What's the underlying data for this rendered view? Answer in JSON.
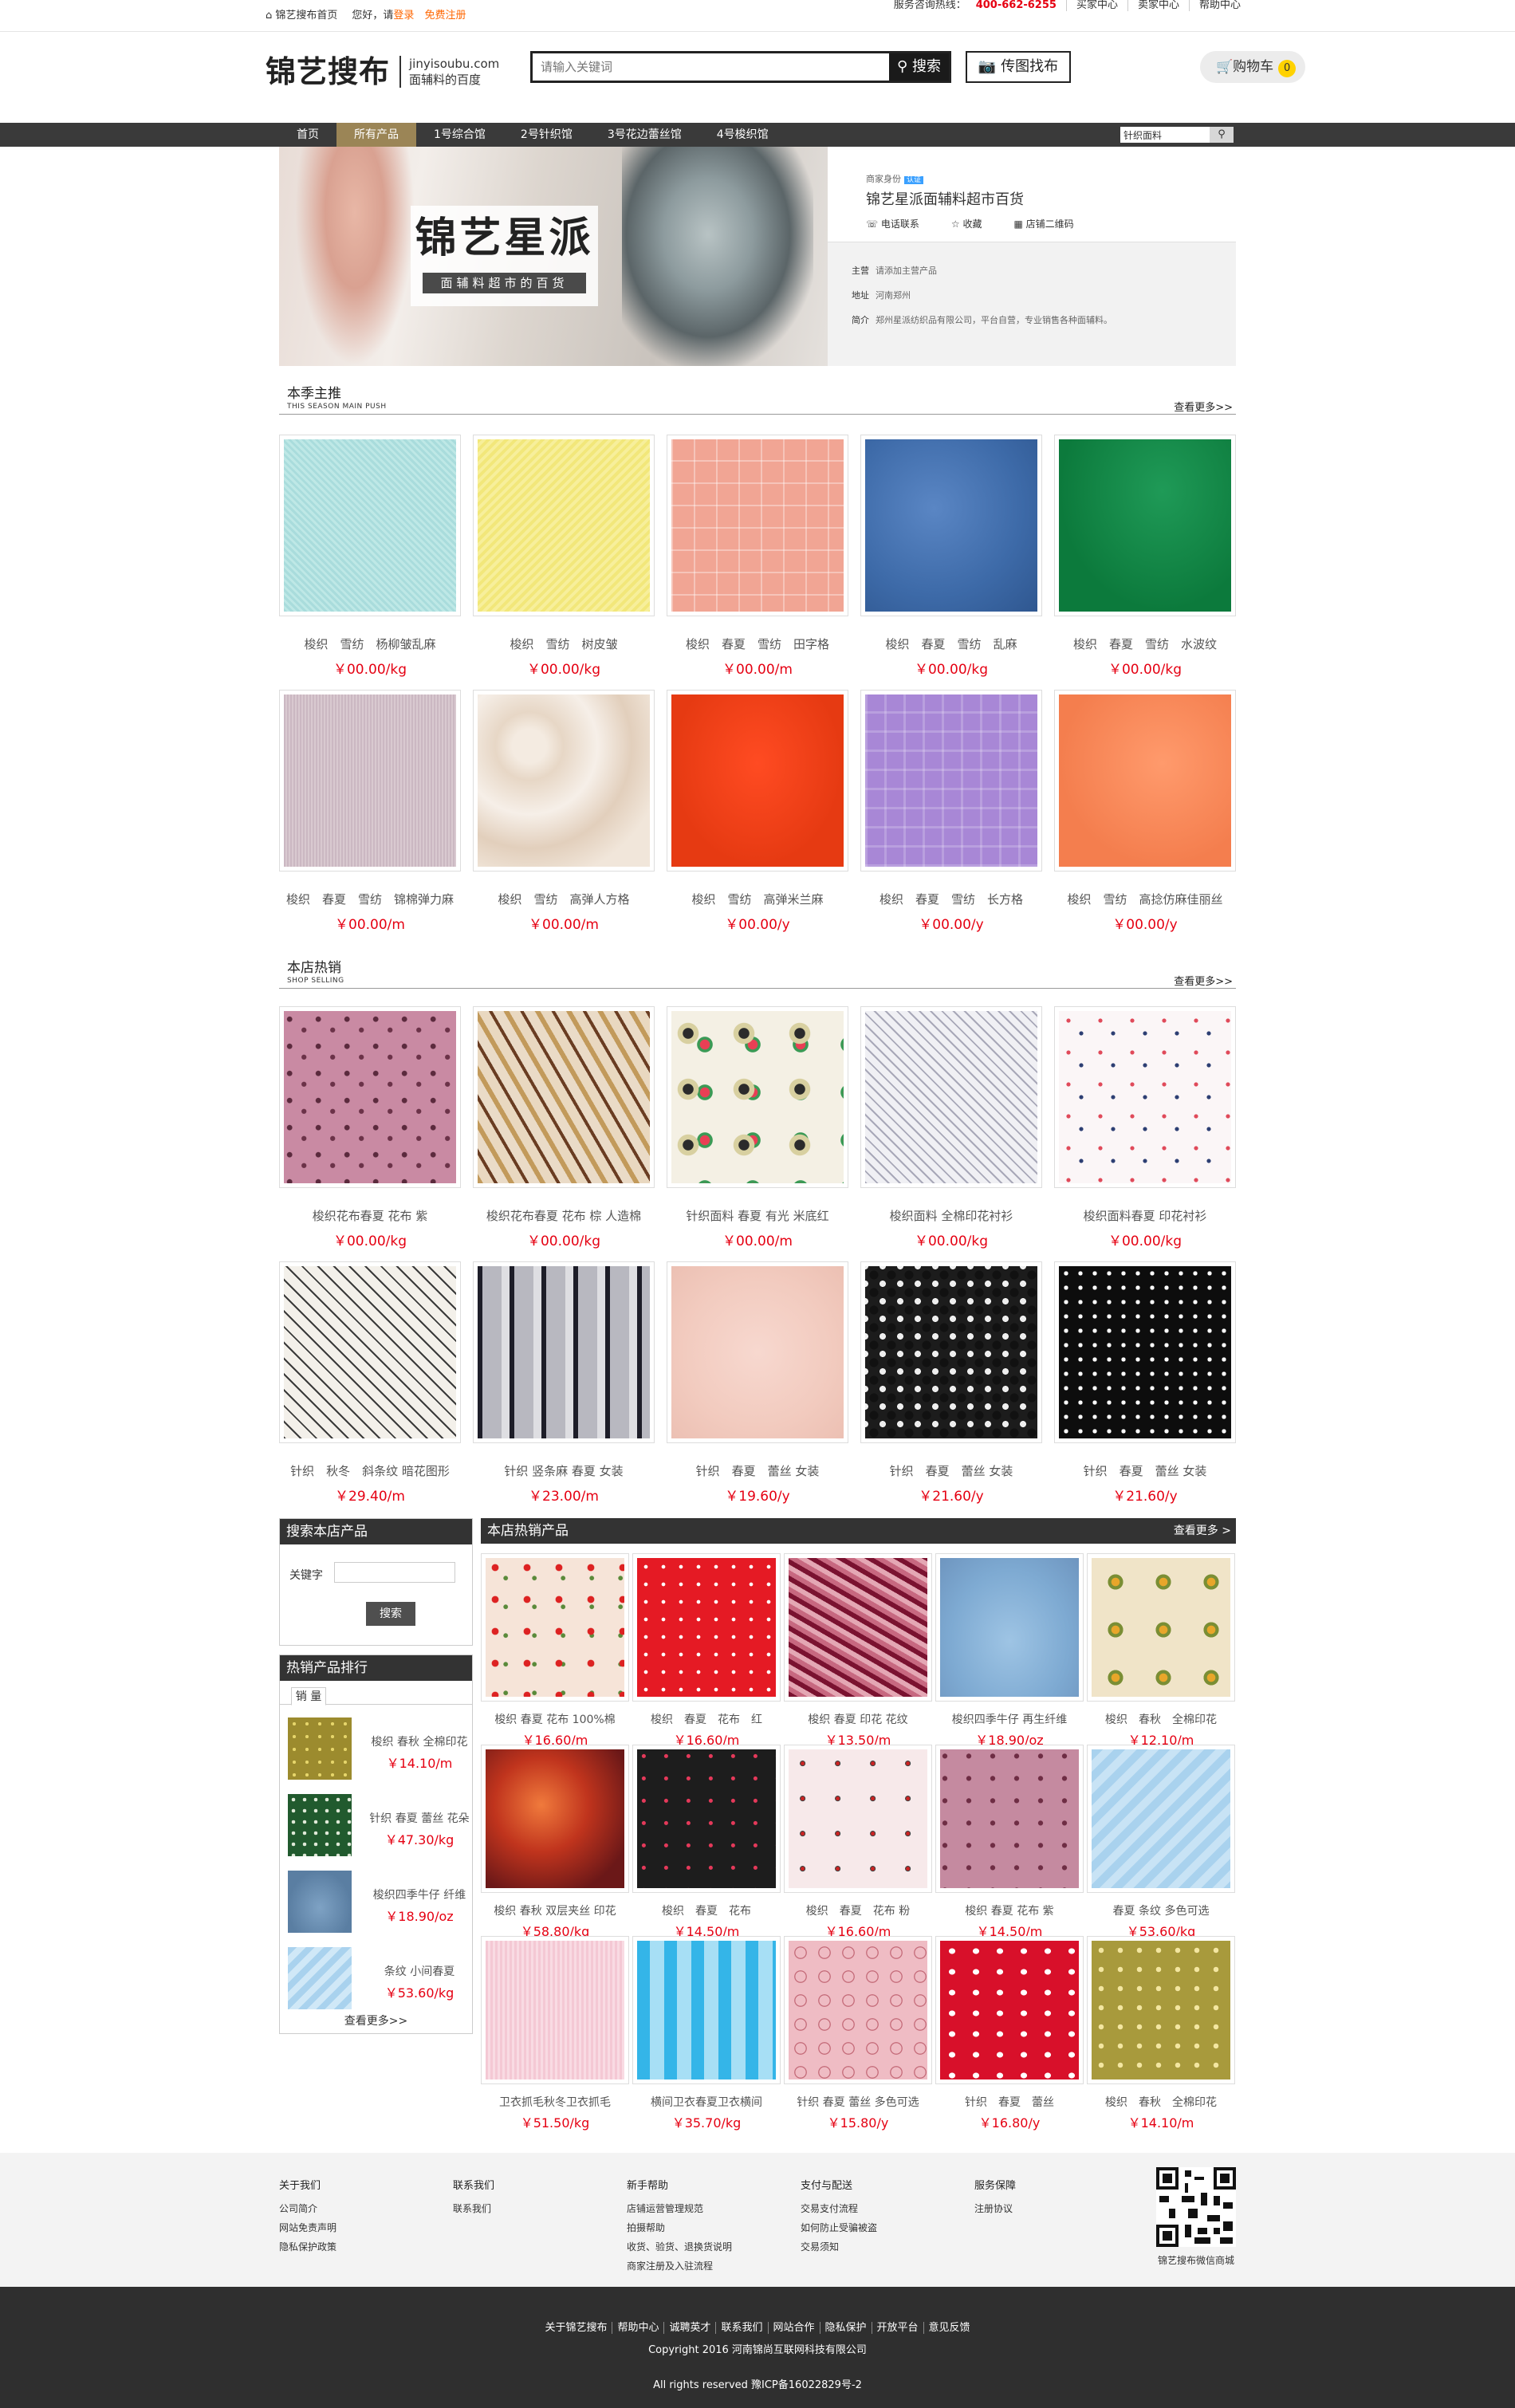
{
  "topbar": {
    "home": "锦艺搜布首页",
    "greeting": "您好，请",
    "login": "登录",
    "register": "免费注册",
    "hotline_label": "服务咨询热线：",
    "hotline": "400-662-6255",
    "buyer_center": "买家中心",
    "seller_center": "卖家中心",
    "help_center": "帮助中心"
  },
  "header": {
    "brand": "锦艺搜布",
    "domain": "jinyisoubu.com",
    "slogan": "面辅料的百度",
    "search_placeholder": "请输入关键词",
    "search_button": "搜索",
    "picture_search": "传图找布",
    "cart_label": "购物车",
    "cart_count": "0"
  },
  "nav": {
    "items": [
      "首页",
      "所有产品",
      "1号综合馆",
      "2号针织馆",
      "3号花边蕾丝馆",
      "4号梭织馆"
    ],
    "active_index": 1,
    "search_value": "针织面料"
  },
  "banner": {
    "title": "锦艺星派",
    "subtitle": "面辅料超市的百货"
  },
  "shop": {
    "identity_label": "商家身份",
    "identity_tag": "认证",
    "name": "锦艺星派面辅料超市百货",
    "phone": "电话联系",
    "favorite": "收藏",
    "qrcode": "店铺二维码",
    "main_label": "主营",
    "main_value": "请添加主营产品",
    "addr_label": "地址",
    "addr_value": "河南郑州",
    "intro_label": "简介",
    "intro_value": "郑州星派纺织品有限公司，平台自营，专业销售各种面辅料。"
  },
  "season": {
    "title": "本季主推",
    "subtitle": "THIS SEASON MAIN PUSH",
    "more": "查看更多>>",
    "products": [
      {
        "name": "梭织　雪纺　杨柳皱乱麻",
        "price": "￥00.00/kg",
        "swatch": "c1"
      },
      {
        "name": "梭织　雪纺　树皮皱",
        "price": "￥00.00/kg",
        "swatch": "c2"
      },
      {
        "name": "梭织　春夏　雪纺　田字格",
        "price": "￥00.00/m",
        "swatch": "c3"
      },
      {
        "name": "梭织　春夏　雪纺　乱麻",
        "price": "￥00.00/kg",
        "swatch": "c4"
      },
      {
        "name": "梭织　春夏　雪纺　水波纹",
        "price": "￥00.00/kg",
        "swatch": "c5"
      },
      {
        "name": "梭织　春夏　雪纺　锦棉弹力麻",
        "price": "￥00.00/m",
        "swatch": "c6"
      },
      {
        "name": "梭织　雪纺　高弹人方格",
        "price": "￥00.00/m",
        "swatch": "c7"
      },
      {
        "name": "梭织　雪纺　高弹米兰麻",
        "price": "￥00.00/y",
        "swatch": "c8"
      },
      {
        "name": "梭织　春夏　雪纺　长方格",
        "price": "￥00.00/y",
        "swatch": "c9"
      },
      {
        "name": "梭织　雪纺　高捻仿麻佳丽丝",
        "price": "￥00.00/y",
        "swatch": "c10"
      }
    ]
  },
  "hot_sale": {
    "title": "本店热销",
    "subtitle": "SHOP SELLING",
    "more": "查看更多>>",
    "products": [
      {
        "name": "梭织花布春夏 花布 紫",
        "price": "￥00.00/kg",
        "swatch": "p1"
      },
      {
        "name": "梭织花布春夏 花布 棕 人造棉",
        "price": "￥00.00/kg",
        "swatch": "p2"
      },
      {
        "name": "针织面料 春夏 有光 米底红",
        "price": "￥00.00/m",
        "swatch": "p3"
      },
      {
        "name": "梭织面料 全棉印花衬衫",
        "price": "￥00.00/kg",
        "swatch": "p4"
      },
      {
        "name": "梭织面料春夏 印花衬衫",
        "price": "￥00.00/kg",
        "swatch": "p5"
      },
      {
        "name": "针织　秋冬　斜条纹 暗花图形",
        "price": "￥29.40/m",
        "swatch": "p6"
      },
      {
        "name": "针织 竖条麻 春夏 女装",
        "price": "￥23.00/m",
        "swatch": "p7"
      },
      {
        "name": "针织　春夏　蕾丝 女装",
        "price": "￥19.60/y",
        "swatch": "p8"
      },
      {
        "name": "针织　春夏　蕾丝 女装",
        "price": "￥21.60/y",
        "swatch": "p9"
      },
      {
        "name": "针织　春夏　蕾丝 女装",
        "price": "￥21.60/y",
        "swatch": "p10"
      }
    ]
  },
  "side_search": {
    "title": "搜索本店产品",
    "keyword_label": "关键字",
    "button": "搜索"
  },
  "ranking": {
    "title": "热销产品排行",
    "tab": "销 量",
    "more": "查看更多>>",
    "items": [
      {
        "name": "梭织 春秋 全棉印花",
        "price": "￥14.10/m",
        "swatch": "r1"
      },
      {
        "name": "针织 春夏 蕾丝 花朵",
        "price": "￥47.30/kg",
        "swatch": "r2"
      },
      {
        "name": "梭织四季牛仔 纤维",
        "price": "￥18.90/oz",
        "swatch": "r3"
      },
      {
        "name": "条纹 小间春夏",
        "price": "￥53.60/kg",
        "swatch": "r4"
      }
    ]
  },
  "store_hot": {
    "title": "本店热销产品",
    "more": "查看更多 >",
    "products": [
      {
        "name": "梭织 春夏 花布 100%棉",
        "price": "￥16.60/m",
        "swatch": "h1"
      },
      {
        "name": "梭织　春夏　花布　红",
        "price": "￥16.60/m",
        "swatch": "h2"
      },
      {
        "name": "梭织 春夏 印花 花纹",
        "price": "￥13.50/m",
        "swatch": "h3"
      },
      {
        "name": "梭织四季牛仔 再生纤维",
        "price": "￥18.90/oz",
        "swatch": "h4"
      },
      {
        "name": "梭织　春秋　全棉印花",
        "price": "￥12.10/m",
        "swatch": "h5"
      },
      {
        "name": "梭织 春秋 双层夹丝 印花",
        "price": "￥58.80/kg",
        "swatch": "h6"
      },
      {
        "name": "梭织　春夏　花布",
        "price": "￥14.50/m",
        "swatch": "h7"
      },
      {
        "name": "梭织　春夏　花布 粉",
        "price": "￥16.60/m",
        "swatch": "h8"
      },
      {
        "name": "梭织 春夏 花布 紫",
        "price": "￥14.50/m",
        "swatch": "h9"
      },
      {
        "name": "春夏 条纹 多色可选",
        "price": "￥53.60/kg",
        "swatch": "h10"
      },
      {
        "name": "卫衣抓毛秋冬卫衣抓毛",
        "price": "￥51.50/kg",
        "swatch": "h11"
      },
      {
        "name": "横间卫衣春夏卫衣横间",
        "price": "￥35.70/kg",
        "swatch": "h12"
      },
      {
        "name": "针织 春夏 蕾丝 多色可选",
        "price": "￥15.80/y",
        "swatch": "h13"
      },
      {
        "name": "针织　春夏　蕾丝",
        "price": "￥16.80/y",
        "swatch": "h14"
      },
      {
        "name": "梭织　春秋　全棉印花",
        "price": "￥14.10/m",
        "swatch": "h15"
      }
    ]
  },
  "footer": {
    "columns": [
      {
        "title": "关于我们",
        "links": [
          "公司简介",
          "网站免责声明",
          "隐私保护政策"
        ]
      },
      {
        "title": "联系我们",
        "links": [
          "联系我们"
        ]
      },
      {
        "title": "新手帮助",
        "links": [
          "店铺运营管理规范",
          "拍摄帮助",
          "收货、验货、退换货说明",
          "商家注册及入驻流程"
        ]
      },
      {
        "title": "支付与配送",
        "links": [
          "交易支付流程",
          "如何防止受骗被盗",
          "交易须知"
        ]
      },
      {
        "title": "服务保障",
        "links": [
          "注册协议"
        ]
      }
    ],
    "qr_caption": "锦艺搜布微信商城",
    "bottom_links": [
      "关于锦艺搜布",
      "帮助中心",
      "诚聘英才",
      "联系我们",
      "网站合作",
      "隐私保护",
      "开放平台",
      "意见反馈"
    ],
    "copyright": "Copyright 2016 河南锦尚互联网科技有限公司",
    "rights": "All rights reserved 豫ICP备16022829号-2"
  }
}
